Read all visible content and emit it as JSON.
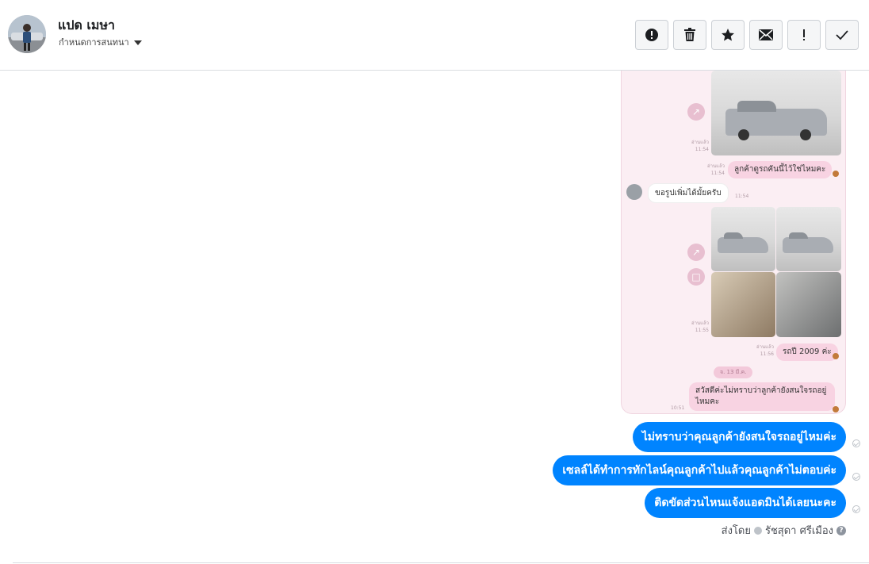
{
  "header": {
    "contact_name": "แปด เมษา",
    "conversation_menu_label": "กำหนดการสนทนา",
    "toolbar_icons": [
      "alert-icon",
      "trash-icon",
      "star-icon",
      "envelope-icon",
      "exclamation-icon",
      "check-icon"
    ]
  },
  "attachment": {
    "messages": [
      {
        "read_label": "อ่านแล้ว",
        "time": "11:54"
      },
      {
        "read_label": "อ่านแล้ว",
        "time": "11:54",
        "text": "ลูกค้าดูรถคันนี้ไว้ใช่ไหมคะ"
      },
      {
        "time": "11:54",
        "text": "ขอรูปเพิ่มได้มั้ยครับ"
      },
      {
        "read_label": "อ่านแล้ว",
        "time": "11:55"
      },
      {
        "read_label": "อ่านแล้ว",
        "time": "11:56",
        "text": "รถปี 2009 ค่ะ"
      },
      {
        "date": "จ. 13 มี.ค."
      },
      {
        "time": "10:51",
        "text": "สวัสดีค่ะไม่ทราบว่าลูกค้ายังสนใจรถอยู่ไหมคะ"
      }
    ]
  },
  "messages": [
    {
      "text": "ไม่ทราบว่าคุณลูกค้ายังสนใจรถอยู่ไหมค่ะ"
    },
    {
      "text": "เซลล์ได้ทำการทักไลน์คุณลูกค้าไปแล้วคุณลูกค้าไม่ตอบค่ะ"
    },
    {
      "text": "ติดขัดส่วนไหนแจ้งแอดมินได้เลยนะคะ"
    }
  ],
  "sent_by": {
    "label": "ส่งโดย",
    "name": "รัชสุดา ศรีเมือง"
  },
  "colors": {
    "messenger_blue": "#0084ff",
    "line_pink": "#fbeef3"
  }
}
